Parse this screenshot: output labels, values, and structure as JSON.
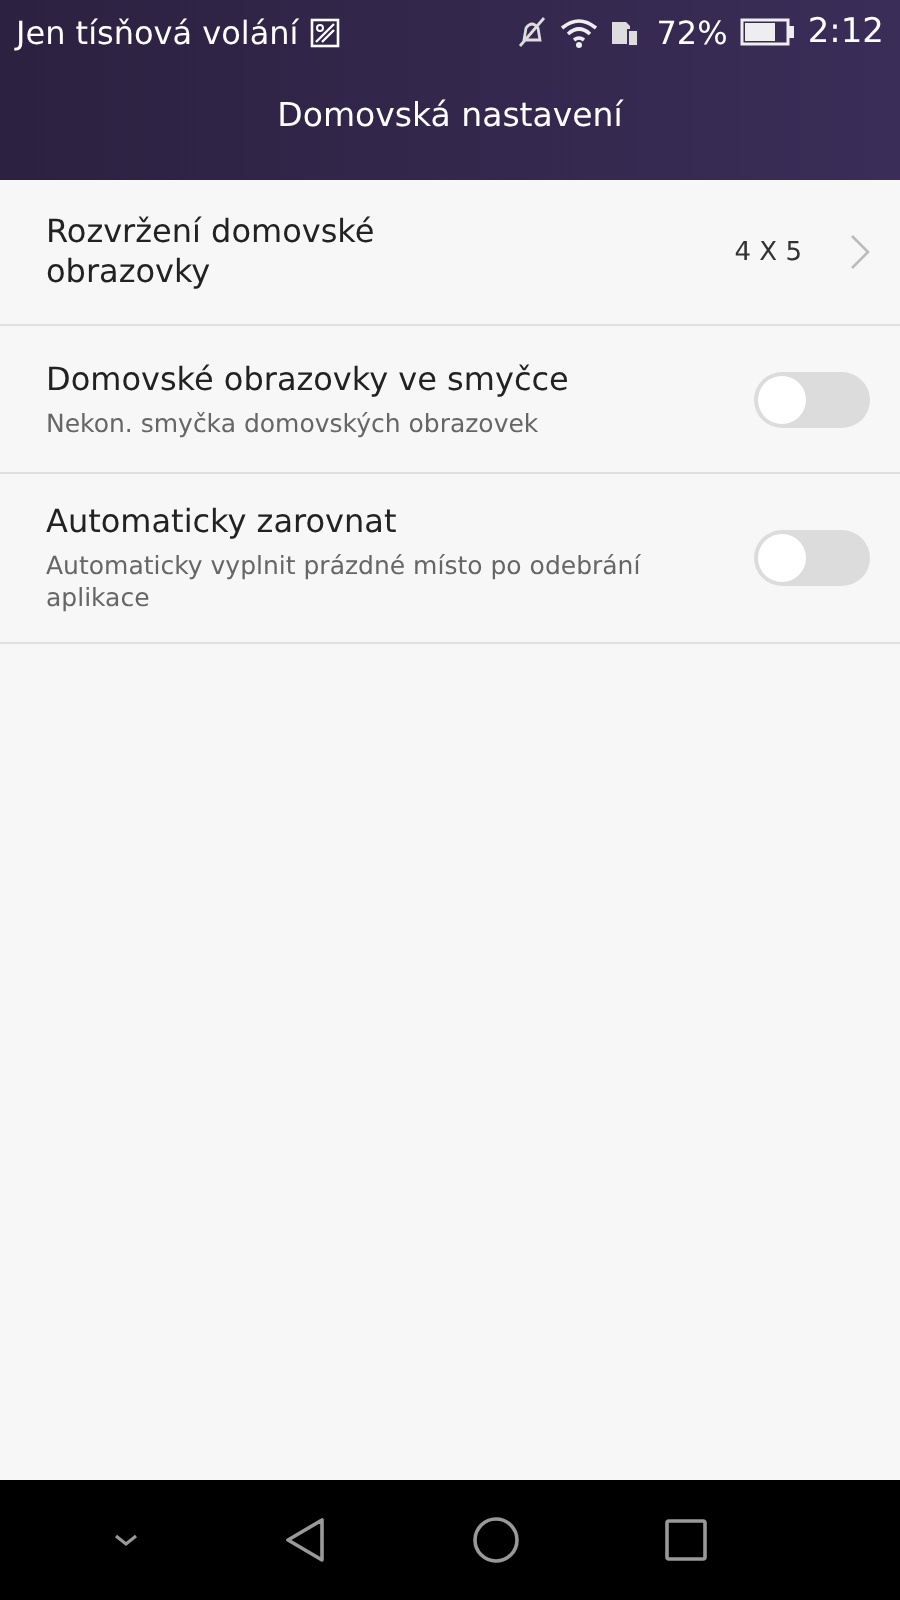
{
  "status_bar": {
    "carrier": "Jen tísňová volání",
    "battery_percent": "72%",
    "time": "2:12"
  },
  "header": {
    "title": "Domovská nastavení"
  },
  "settings": [
    {
      "kind": "value",
      "title": "Rozvržení domovské obrazovky",
      "value": "4 X 5"
    },
    {
      "kind": "toggle",
      "title": "Domovské obrazovky ve smyčce",
      "subtitle": "Nekon. smyčka domovských obrazovek",
      "on": false
    },
    {
      "kind": "toggle",
      "title": "Automaticky zarovnat",
      "subtitle": "Automaticky vyplnit prázdné místo po odebrání aplikace",
      "on": false
    }
  ]
}
